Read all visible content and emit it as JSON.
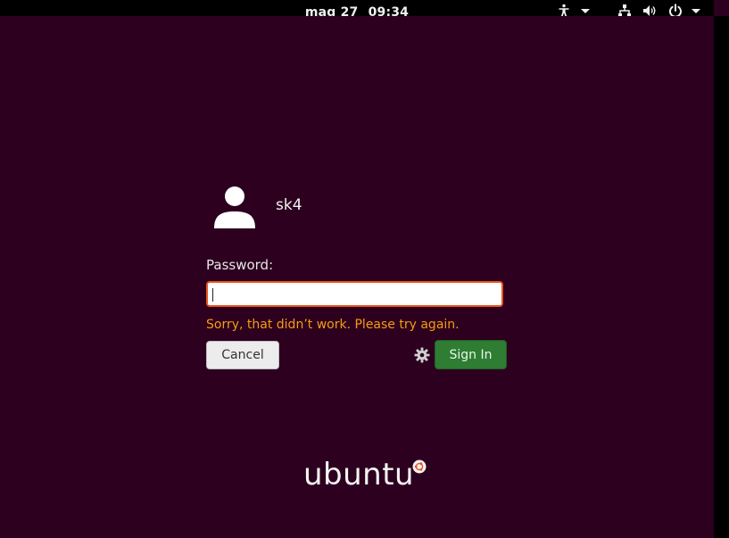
{
  "topbar": {
    "date": "mag 27",
    "time": "09:34",
    "icons": [
      "accessibility-icon",
      "chevron-down-icon",
      "network-icon",
      "volume-icon",
      "power-icon",
      "chevron-down-icon"
    ]
  },
  "user": {
    "name": "sk4",
    "avatar_icon": "user-avatar-icon"
  },
  "login": {
    "password_label": "Password:",
    "password_value": "",
    "error_message": "Sorry, that didn’t work. Please try again.",
    "cancel_label": "Cancel",
    "signin_label": "Sign In",
    "session_icon": "gear-icon"
  },
  "branding": {
    "logo_text": "ubuntu",
    "logo_mark": "circle-of-friends-icon"
  },
  "colors": {
    "background": "#2c001e",
    "topbar": "#000000",
    "error": "#f99b11",
    "input_border": "#e95420",
    "signin_button": "#2e7d32"
  }
}
